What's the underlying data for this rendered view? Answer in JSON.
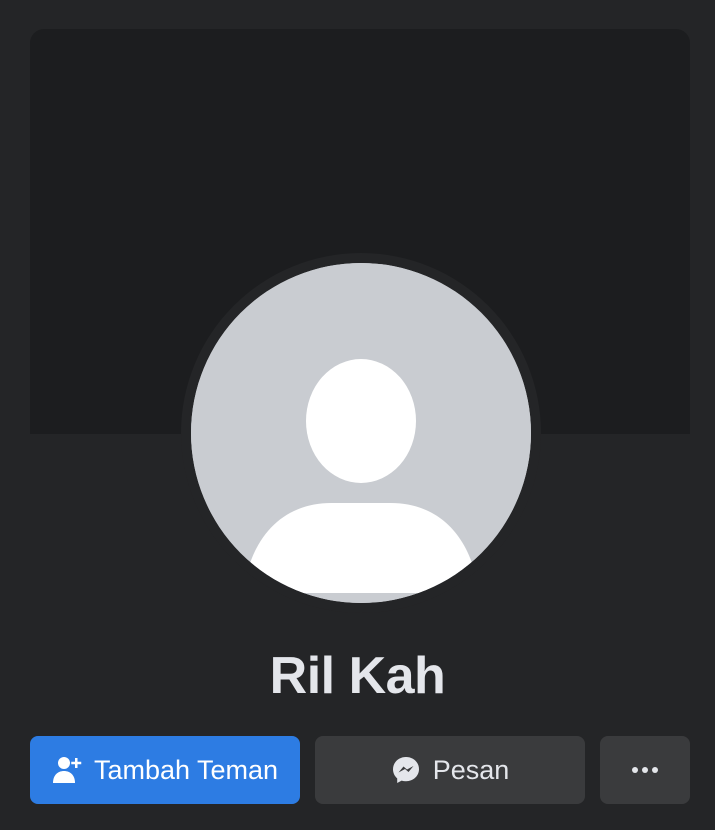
{
  "profile": {
    "name": "Ril Kah"
  },
  "actions": {
    "add_friend_label": "Tambah Teman",
    "message_label": "Pesan",
    "more_icon": "ellipsis-icon"
  },
  "icons": {
    "add_friend": "person-plus-icon",
    "message": "messenger-icon",
    "avatar": "default-avatar-icon"
  },
  "colors": {
    "background": "#242527",
    "cover": "#1c1d1f",
    "primary": "#2d7ce3",
    "secondary_button": "#3a3b3d",
    "text": "#e4e6eb",
    "avatar_bg": "#c9ccd1"
  }
}
